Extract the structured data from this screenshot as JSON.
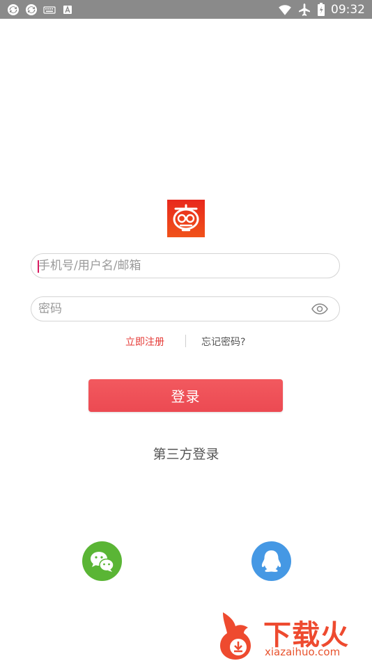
{
  "status_bar": {
    "time": "09:32",
    "left_icons": [
      "sync-icon",
      "sync-icon",
      "keyboard-icon",
      "a-icon"
    ],
    "right_icons": [
      "wifi-icon",
      "airplane-icon",
      "battery-icon"
    ]
  },
  "app": {
    "logo_icon": "app-logo-icon",
    "brand_color": "#e53935"
  },
  "form": {
    "username_placeholder": "手机号/用户名/邮箱",
    "password_placeholder": "密码",
    "register_label": "立即注册",
    "forgot_label": "忘记密码?",
    "login_label": "登录"
  },
  "third_party": {
    "title": "第三方登录",
    "providers": [
      {
        "name": "wechat-icon",
        "color": "#5ab535"
      },
      {
        "name": "qq-icon",
        "color": "#4598e4"
      }
    ]
  },
  "watermark": {
    "text": "下载火",
    "url": "xiazaihuo.com"
  }
}
